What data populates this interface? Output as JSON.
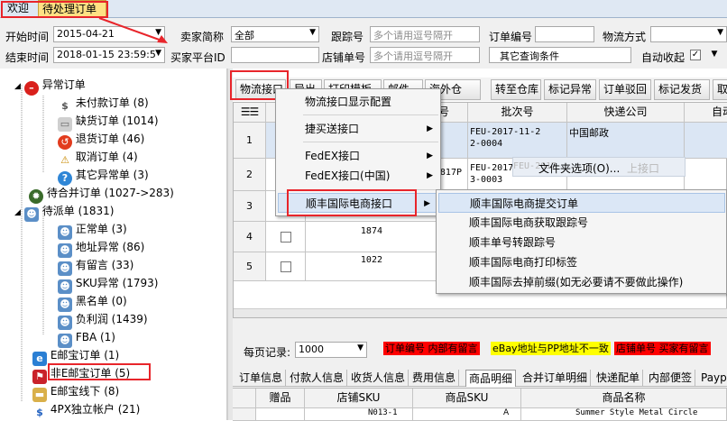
{
  "tabs": [
    {
      "label": "欢迎"
    },
    {
      "label": "待处理订单"
    }
  ],
  "filter": {
    "start_label": "开始时间",
    "start_value": "2015-04-21",
    "end_label": "结束时间",
    "end_value": "2018-01-15 23:59:5",
    "seller_label": "卖家简称",
    "seller_value": "全部",
    "buyer_id_label": "买家平台ID",
    "track_label": "跟踪号",
    "track_placeholder": "多个请用逗号隔开",
    "store_order_label": "店铺单号",
    "store_order_placeholder": "多个请用逗号隔开",
    "order_no_label": "订单编号",
    "logistics_label": "物流方式",
    "other_label": "其它查询条件",
    "auto_merge_label": "自动收起",
    "auto_merge_checked": "✓"
  },
  "tree": [
    {
      "label": "异常订单",
      "icon": "stop-icon"
    },
    {
      "label": "未付款订单 (8)",
      "icon": "dollar-icon"
    },
    {
      "label": "缺货订单 (1014)",
      "icon": "box-icon"
    },
    {
      "label": "退货订单 (46)",
      "icon": "return-icon"
    },
    {
      "label": "取消订单 (4)",
      "icon": "warning-icon"
    },
    {
      "label": "其它异常单 (3)",
      "icon": "question-icon"
    },
    {
      "label": "待合并订单 (1027->283)",
      "icon": "gear-icon"
    },
    {
      "label": "待派单 (1831)",
      "icon": "user-icon"
    },
    {
      "label": "正常单 (3)",
      "icon": "user-icon"
    },
    {
      "label": "地址异常 (86)",
      "icon": "user-icon"
    },
    {
      "label": "有留言 (33)",
      "icon": "user-icon"
    },
    {
      "label": "SKU异常 (1793)",
      "icon": "user-icon"
    },
    {
      "label": "黑名单 (0)",
      "icon": "user-icon"
    },
    {
      "label": "负利润 (1439)",
      "icon": "user-icon"
    },
    {
      "label": "FBA (1)",
      "icon": "user-icon"
    },
    {
      "label": "E邮宝订单 (1)",
      "icon": "ie-icon"
    },
    {
      "label": "非E邮宝订单 (5)",
      "icon": "flag-icon"
    },
    {
      "label": "E邮宝线下 (8)",
      "icon": "folder-icon"
    },
    {
      "label": "4PX独立帐户 (21)",
      "icon": "dollar-icon"
    }
  ],
  "toolbar": [
    {
      "label": "物流接口"
    },
    {
      "label": "导出"
    },
    {
      "label": "打印模板"
    },
    {
      "label": "邮件"
    },
    {
      "label": "海外仓"
    },
    {
      "label": "转至仓库"
    },
    {
      "label": "标记异常"
    },
    {
      "label": "订单驳回"
    },
    {
      "label": "标记发货"
    },
    {
      "label": "取"
    }
  ],
  "grid": {
    "headers": [
      "号",
      "批次号",
      "快递公司",
      "自动"
    ],
    "rows": [
      {
        "num": "1",
        "batch": "FEU-2017-11-2\n2-0004",
        "courier": "中国邮政",
        "track": ""
      },
      {
        "num": "2",
        "batch": "FEU-2017-11-2\n3-0003",
        "courier": "",
        "track": "0817P"
      },
      {
        "num": "3",
        "batch": "",
        "courier": "",
        "track": ""
      },
      {
        "num": "4",
        "batch": "",
        "courier": "",
        "track": "1874"
      },
      {
        "num": "5",
        "batch": "",
        "courier": "",
        "track": "1022"
      }
    ]
  },
  "menu": {
    "items": [
      {
        "label": "物流接口显示配置"
      },
      {
        "label": "捷买送接口"
      },
      {
        "label": "FedEX接口"
      },
      {
        "label": "FedEX接口(中国)"
      },
      {
        "label": "顺丰国际电商接口"
      }
    ],
    "submenu": [
      {
        "label": "顺丰国际电商提交订单"
      },
      {
        "label": "顺丰国际电商获取跟踪号"
      },
      {
        "label": "顺丰单号转跟踪号"
      },
      {
        "label": "顺丰国际电商打印标签"
      },
      {
        "label": "顺丰国际去掉前缀(如无必要请不要做此操作)"
      }
    ]
  },
  "ghost": {
    "folder_option": "文件夹选项(O)...",
    "ghost_batch": "FEU-2017-",
    "ghost_iface": "上接口"
  },
  "bottom": {
    "per_page_label": "每页记录:",
    "per_page_value": "1000",
    "legend": [
      {
        "label": "订单编号 内部有留言",
        "bg": "#ff0000",
        "fg": "#1a1a1a"
      },
      {
        "label": "eBay地址与PP地址不一致",
        "bg": "#ffff00",
        "fg": "#1a1a1a"
      },
      {
        "label": "店铺单号 买家有留言",
        "bg": "#ff0000",
        "fg": "#1a1a1a"
      }
    ],
    "tabs": [
      "订单信息",
      "付款人信息",
      "收货人信息",
      "费用信息",
      "商品明细",
      "合并订单明细",
      "快递配单",
      "内部便签",
      "Paypal"
    ],
    "detail_headers": [
      "赠品",
      "店铺SKU",
      "商品SKU",
      "商品名称"
    ],
    "detail_row": {
      "sku": "N013-1",
      "psku": "A",
      "name": "Summer Style Metal Circle"
    }
  }
}
